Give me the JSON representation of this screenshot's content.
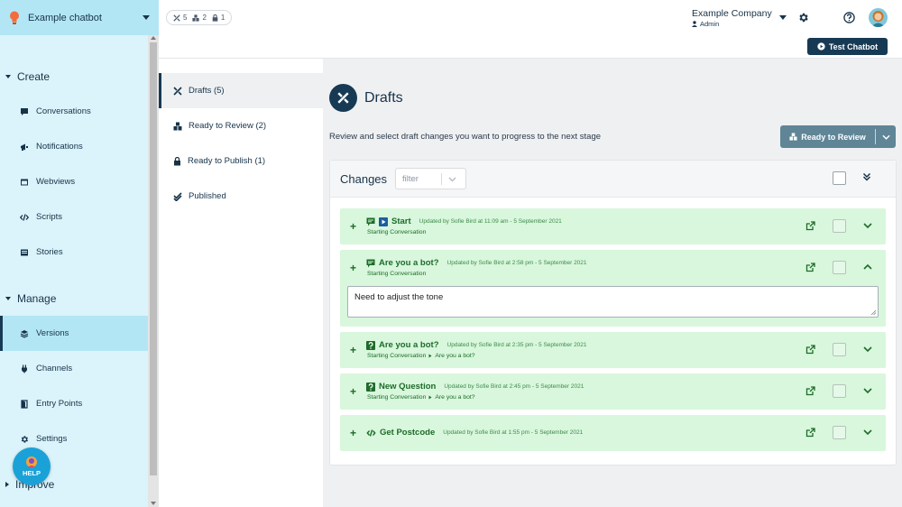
{
  "bot": {
    "name": "Example chatbot"
  },
  "stats": {
    "drafts": "5",
    "review": "2",
    "publish": "1"
  },
  "account": {
    "company": "Example Company",
    "role": "Admin"
  },
  "toolbar": {
    "test_label": "Test Chatbot"
  },
  "sidebar": {
    "create_label": "Create",
    "manage_label": "Manage",
    "improve_label": "Improve",
    "create_items": [
      {
        "label": "Conversations"
      },
      {
        "label": "Notifications"
      },
      {
        "label": "Webviews"
      },
      {
        "label": "Scripts"
      },
      {
        "label": "Stories"
      }
    ],
    "manage_items": [
      {
        "label": "Versions"
      },
      {
        "label": "Channels"
      },
      {
        "label": "Entry Points"
      },
      {
        "label": "Settings"
      }
    ],
    "help_label": "HELP"
  },
  "stages": [
    {
      "label": "Drafts (5)"
    },
    {
      "label": "Ready to Review (2)"
    },
    {
      "label": "Ready to Publish (1)"
    },
    {
      "label": "Published"
    }
  ],
  "main": {
    "title": "Drafts",
    "subtitle": "Review and select draft changes you want to progress to the next stage",
    "action_label": "Ready to Review",
    "changes_label": "Changes",
    "filter_placeholder": "filter"
  },
  "changes": [
    {
      "title": "Start",
      "meta": "Updated by Sofie Bird at 11:09 am - 5 September 2021",
      "crumb1": "Starting Conversation",
      "crumb2": ""
    },
    {
      "title": "Are you a bot?",
      "meta": "Updated by Sofie Bird at 2:58 pm - 5 September 2021",
      "crumb1": "Starting Conversation",
      "crumb2": "",
      "note": "Need to adjust the tone"
    },
    {
      "title": "Are you a bot?",
      "meta": "Updated by Sofie Bird at 2:35 pm - 5 September 2021",
      "crumb1": "Starting Conversation",
      "crumb2": "Are you a bot?"
    },
    {
      "title": "New Question",
      "meta": "Updated by Sofie Bird at 2:45 pm - 5 September 2021",
      "crumb1": "Starting Conversation",
      "crumb2": "Are you a bot?"
    },
    {
      "title": "Get Postcode",
      "meta": "Updated by Sofie Bird at 1:55 pm - 5 September 2021",
      "crumb1": "",
      "crumb2": ""
    }
  ],
  "colors": {
    "navy": "#173a54",
    "sky": "#b3e6f5",
    "mint": "#d8f7dc",
    "green": "#1e6b2a",
    "help": "#1aa2d8"
  }
}
